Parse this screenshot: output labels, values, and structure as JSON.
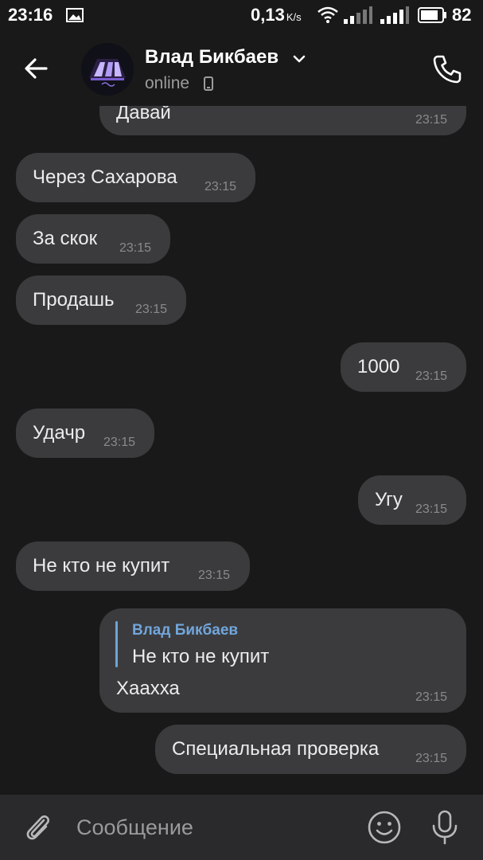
{
  "status_bar": {
    "time": "23:16",
    "network_speed": "0,13",
    "network_speed_unit": "K/s",
    "battery_percent": "82"
  },
  "header": {
    "contact_name": "Влад Бикбаев",
    "status": "online"
  },
  "messages": [
    {
      "side": "out",
      "text": "Давай",
      "time": "23:15"
    },
    {
      "side": "in",
      "text": "Через Сахарова",
      "time": "23:15"
    },
    {
      "side": "in",
      "text": "За скок",
      "time": "23:15"
    },
    {
      "side": "in",
      "text": "Продашь",
      "time": "23:15"
    },
    {
      "side": "out",
      "text": "1000",
      "time": "23:15"
    },
    {
      "side": "in",
      "text": "Удачр",
      "time": "23:15"
    },
    {
      "side": "out",
      "text": "Угу",
      "time": "23:15"
    },
    {
      "side": "in",
      "text": "Не кто не купит",
      "time": "23:15"
    },
    {
      "side": "out",
      "text": "Хаахха",
      "time": "23:15",
      "reply": {
        "author": "Влад Бикбаев",
        "text": "Не кто не купит"
      }
    },
    {
      "side": "out",
      "text": "Специальная проверка",
      "time": "23:15"
    }
  ],
  "composer": {
    "placeholder": "Сообщение"
  },
  "colors": {
    "background": "#19191a",
    "bubble": "#3b3b3d",
    "reply_accent": "#71a6dc",
    "composer": "#2a2a2c"
  },
  "icons": [
    "image-icon",
    "wifi-icon",
    "signal-icon",
    "battery-icon",
    "back-arrow-icon",
    "chevron-down-icon",
    "phone-icon",
    "call-icon",
    "attach-icon",
    "emoji-icon",
    "mic-icon"
  ]
}
